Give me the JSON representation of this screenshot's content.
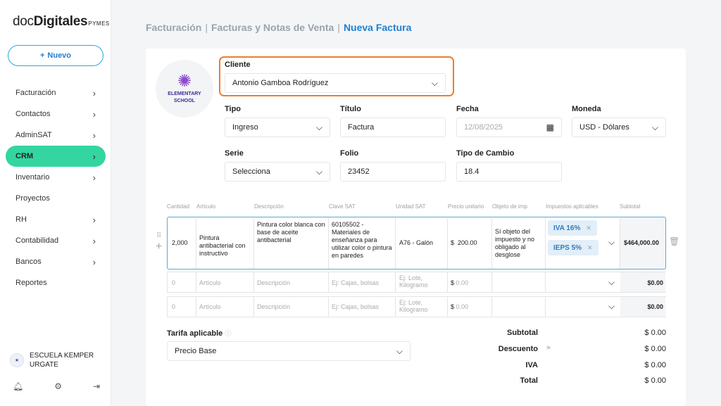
{
  "sidebar": {
    "logo_main": "doc",
    "logo_bold": "Digitales",
    "logo_small": "PYMES",
    "new_button": "Nuevo",
    "items": [
      {
        "label": "Facturación",
        "chevron": true
      },
      {
        "label": "Contactos",
        "chevron": true
      },
      {
        "label": "AdminSAT",
        "chevron": true
      },
      {
        "label": "CRM",
        "chevron": true,
        "active": true
      },
      {
        "label": "Inventario",
        "chevron": true
      },
      {
        "label": "Proyectos",
        "chevron": false
      },
      {
        "label": "RH",
        "chevron": true
      },
      {
        "label": "Contabilidad",
        "chevron": true
      },
      {
        "label": "Bancos",
        "chevron": true
      },
      {
        "label": "Reportes",
        "chevron": false
      }
    ],
    "company_line1": "ESCUELA KEMPER",
    "company_line2": "URGATE"
  },
  "breadcrumb": {
    "level1": "Facturación",
    "level2": "Facturas y Notas de Venta",
    "current": "Nueva Factura"
  },
  "client_logo": {
    "line1": "ELEMENTARY",
    "line2": "SCHOOL"
  },
  "form": {
    "cliente_label": "Cliente",
    "cliente_value": "Antonio Gamboa Rodríguez",
    "tipo_label": "Tipo",
    "tipo_value": "Ingreso",
    "titulo_label": "Título",
    "titulo_value": "Factura",
    "fecha_label": "Fecha",
    "fecha_value": "12/08/2025",
    "moneda_label": "Moneda",
    "moneda_value": "USD - Dólares",
    "serie_label": "Serie",
    "serie_value": "Selecciona",
    "folio_label": "Folio",
    "folio_value": "23452",
    "tipo_cambio_label": "Tipo de Cambio",
    "tipo_cambio_value": "18.4"
  },
  "table": {
    "headers": [
      "Cantidad",
      "Artículo",
      "Descripción",
      "Clave SAT",
      "Unidad SAT",
      "Precio unitario",
      "Objeto de imp.",
      "Impuestos aplicables",
      "Subtotal"
    ],
    "row1": {
      "cantidad": "2,000",
      "articulo": "Pintura antibacterial con instructivo",
      "descripcion": "Pintura color blanca con base de aceite antibacterial",
      "clave_sat": "60105502 - Materiales de enseñanza para utilizar color o pintura en paredes",
      "unidad_sat": "A76 - Galón",
      "precio_currency": "$",
      "precio": "200.00",
      "objeto": "Sí objeto del impuesto y no obligado al desglose",
      "tax1": "IVA 16%",
      "tax2": "IEPS 5%",
      "subtotal": "$464,000.00"
    },
    "placeholders": {
      "cantidad": "0",
      "articulo": "Artículo",
      "descripcion": "Descripción",
      "clave_sat": "Ej: Cajas, bolsas",
      "unidad_sat": "Ej: Lote, Kilogramo",
      "precio_currency": "$",
      "precio": "0.00",
      "subtotal": "$0.00"
    }
  },
  "tarifa": {
    "label": "Tarifa aplicable",
    "value": "Precio Base"
  },
  "totals": {
    "subtotal_label": "Subtotal",
    "subtotal_value": "$ 0.00",
    "descuento_label": "Descuento",
    "descuento_value": "$ 0.00",
    "iva_label": "IVA",
    "iva_value": "$ 0.00",
    "total_label": "Total",
    "total_value": "$ 0.00"
  },
  "colors": {
    "accent_green": "#33d6a0",
    "accent_blue": "#1f7fcf",
    "highlight_orange": "#ea7f2e"
  }
}
